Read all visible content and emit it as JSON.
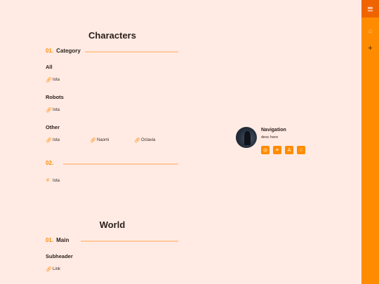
{
  "sections": [
    {
      "title": "Characters",
      "categories": [
        {
          "num": "01.",
          "label": "Category",
          "groups": [
            {
              "subheader": "All",
              "items": [
                {
                  "icon": "link-icon",
                  "label": "Iota"
                }
              ]
            },
            {
              "subheader": "Robots",
              "items": [
                {
                  "icon": "link-icon",
                  "label": "Iota"
                }
              ]
            },
            {
              "subheader": "Other",
              "items": [
                {
                  "icon": "link-icon",
                  "label": "Iota"
                },
                {
                  "icon": "link-icon",
                  "label": "Naomi"
                },
                {
                  "icon": "link-icon",
                  "label": "Octavia"
                }
              ]
            }
          ]
        },
        {
          "num": "02.",
          "label": "",
          "groups": [
            {
              "subheader": "",
              "items": [
                {
                  "icon": "hash-icon",
                  "label": "Iota"
                }
              ]
            }
          ]
        }
      ]
    },
    {
      "title": "World",
      "categories": [
        {
          "num": "01.",
          "label": "Main",
          "groups": [
            {
              "subheader": "Subheader",
              "items": [
                {
                  "icon": "link-icon",
                  "label": "Link"
                }
              ]
            }
          ]
        }
      ]
    }
  ],
  "navigation": {
    "title": "Navigation",
    "desc": "desc here",
    "buttons": [
      "compass-icon",
      "link-icon",
      "letter-a-icon",
      "star-icon"
    ]
  },
  "rightbar": {
    "items": [
      "menu-icon",
      "bookmark-icon",
      "plus-icon"
    ]
  },
  "colors": {
    "accent": "#ff8c00",
    "background": "#ffebe4",
    "accent_dark": "#f06400"
  }
}
